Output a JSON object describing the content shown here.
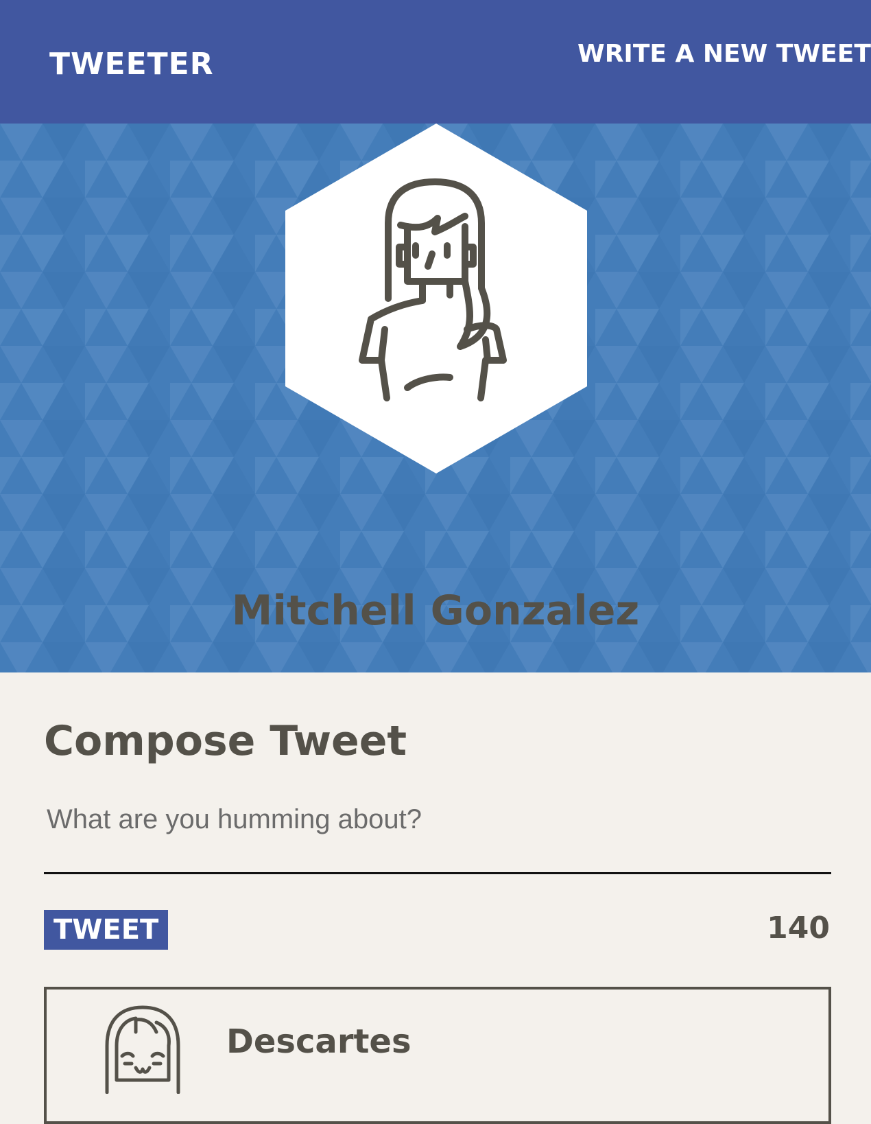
{
  "nav": {
    "brand": "Tweeter",
    "write_link": "Write a new tweet"
  },
  "profile": {
    "name": "Mitchell Gonzalez",
    "avatar_icon": "woman-avatar-icon"
  },
  "compose": {
    "title": "Compose Tweet",
    "placeholder": "What are you humming about?",
    "button_label": "Tweet",
    "counter": "140"
  },
  "tweets": [
    {
      "author": "Descartes",
      "avatar_icon": "girl-avatar-icon"
    }
  ],
  "colors": {
    "nav": "#4157a0",
    "hero": "#447db9",
    "text": "#545149",
    "page": "#f4f1ec"
  }
}
